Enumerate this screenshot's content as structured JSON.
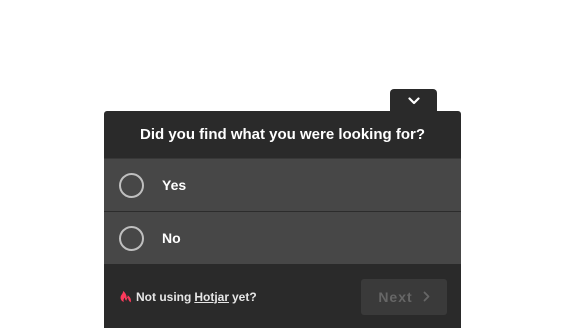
{
  "widget": {
    "question": "Did you find what you were looking for?",
    "options": [
      {
        "label": "Yes"
      },
      {
        "label": "No"
      }
    ],
    "footer": {
      "branding_prefix": "Not using",
      "branding_link": "Hotjar",
      "branding_suffix": "yet?",
      "next_label": "Next"
    }
  },
  "icons": {
    "collapse": "chevron-down-icon",
    "brand": "hotjar-logo-icon",
    "next": "chevron-right-icon"
  },
  "colors": {
    "panel": "#2a2a2a",
    "option_bg": "#474747",
    "radio_border": "#bfbfbf",
    "brand_logo": "#fd3a5c",
    "next_disabled_text": "#666666"
  }
}
